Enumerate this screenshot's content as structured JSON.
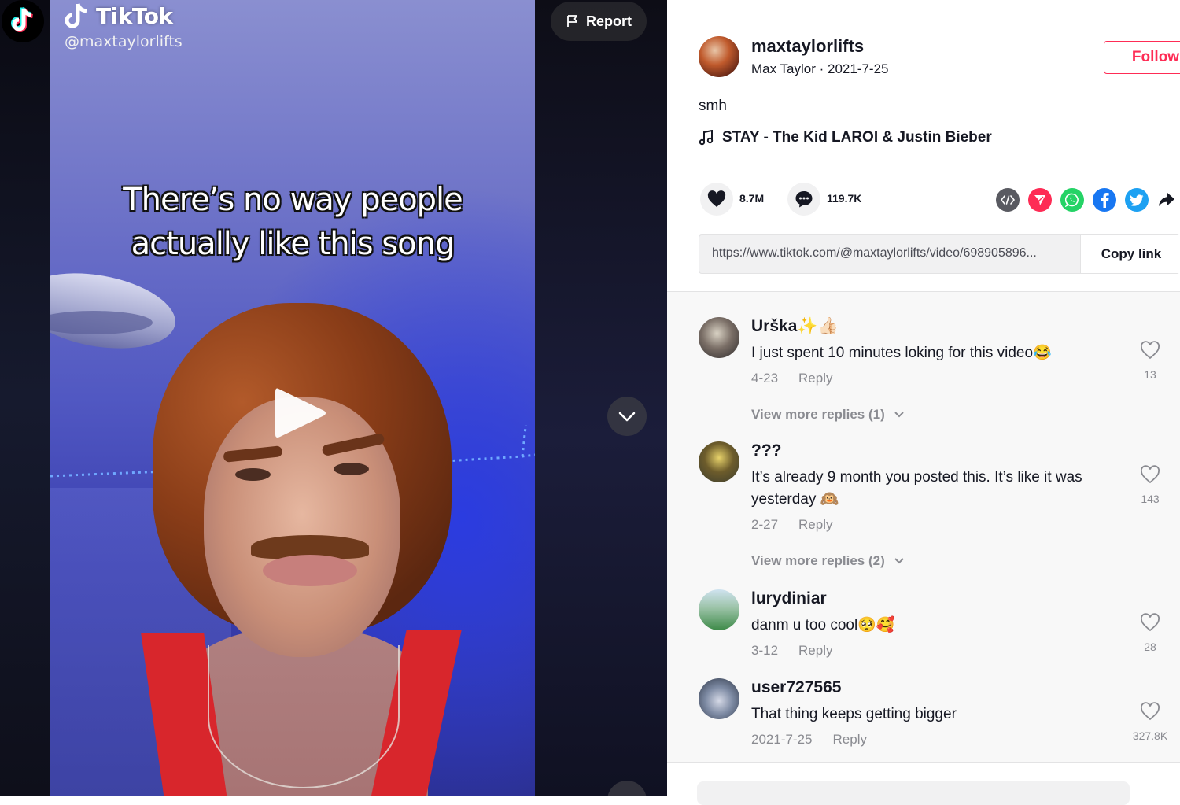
{
  "video": {
    "brand": "TikTok",
    "handle": "@maxtaylorlifts",
    "caption_lines": [
      "There’s no way people",
      "actually like this song"
    ],
    "report_label": "Report"
  },
  "author": {
    "username": "maxtaylorlifts",
    "subtitle": "Max Taylor · 2021-7-25",
    "follow_label": "Follow"
  },
  "post": {
    "description": "smh",
    "music": "STAY - The Kid LAROI & Justin Bieber",
    "likes": "8.7M",
    "comments": "119.7K",
    "link": "https://www.tiktok.com/@maxtaylorlifts/video/698905896...",
    "copy_link_label": "Copy link"
  },
  "share_icons": [
    "embed-icon",
    "send-icon",
    "whatsapp-icon",
    "facebook-icon",
    "twitter-icon",
    "share-arrow-icon"
  ],
  "comments": [
    {
      "user": "Urška✨👍🏻",
      "text": "I just spent 10 minutes loking for this video😂",
      "date": "4-23",
      "reply": "Reply",
      "likes": "13",
      "more": "View more replies (1)"
    },
    {
      "user": "???",
      "text": "It’s already 9 month you posted this. It’s like it was yesterday 🙉",
      "date": "2-27",
      "reply": "Reply",
      "likes": "143",
      "more": "View more replies (2)"
    },
    {
      "user": "lurydiniar",
      "text": "danm u too cool🥺🥰",
      "date": "3-12",
      "reply": "Reply",
      "likes": "28"
    },
    {
      "user": "user727565",
      "text": "That thing keeps getting bigger",
      "date": "2021-7-25",
      "reply": "Reply",
      "likes": "327.8K"
    }
  ],
  "colors": {
    "accent": "#fe2c55",
    "text": "#161823",
    "muted": "#8a8b91"
  }
}
